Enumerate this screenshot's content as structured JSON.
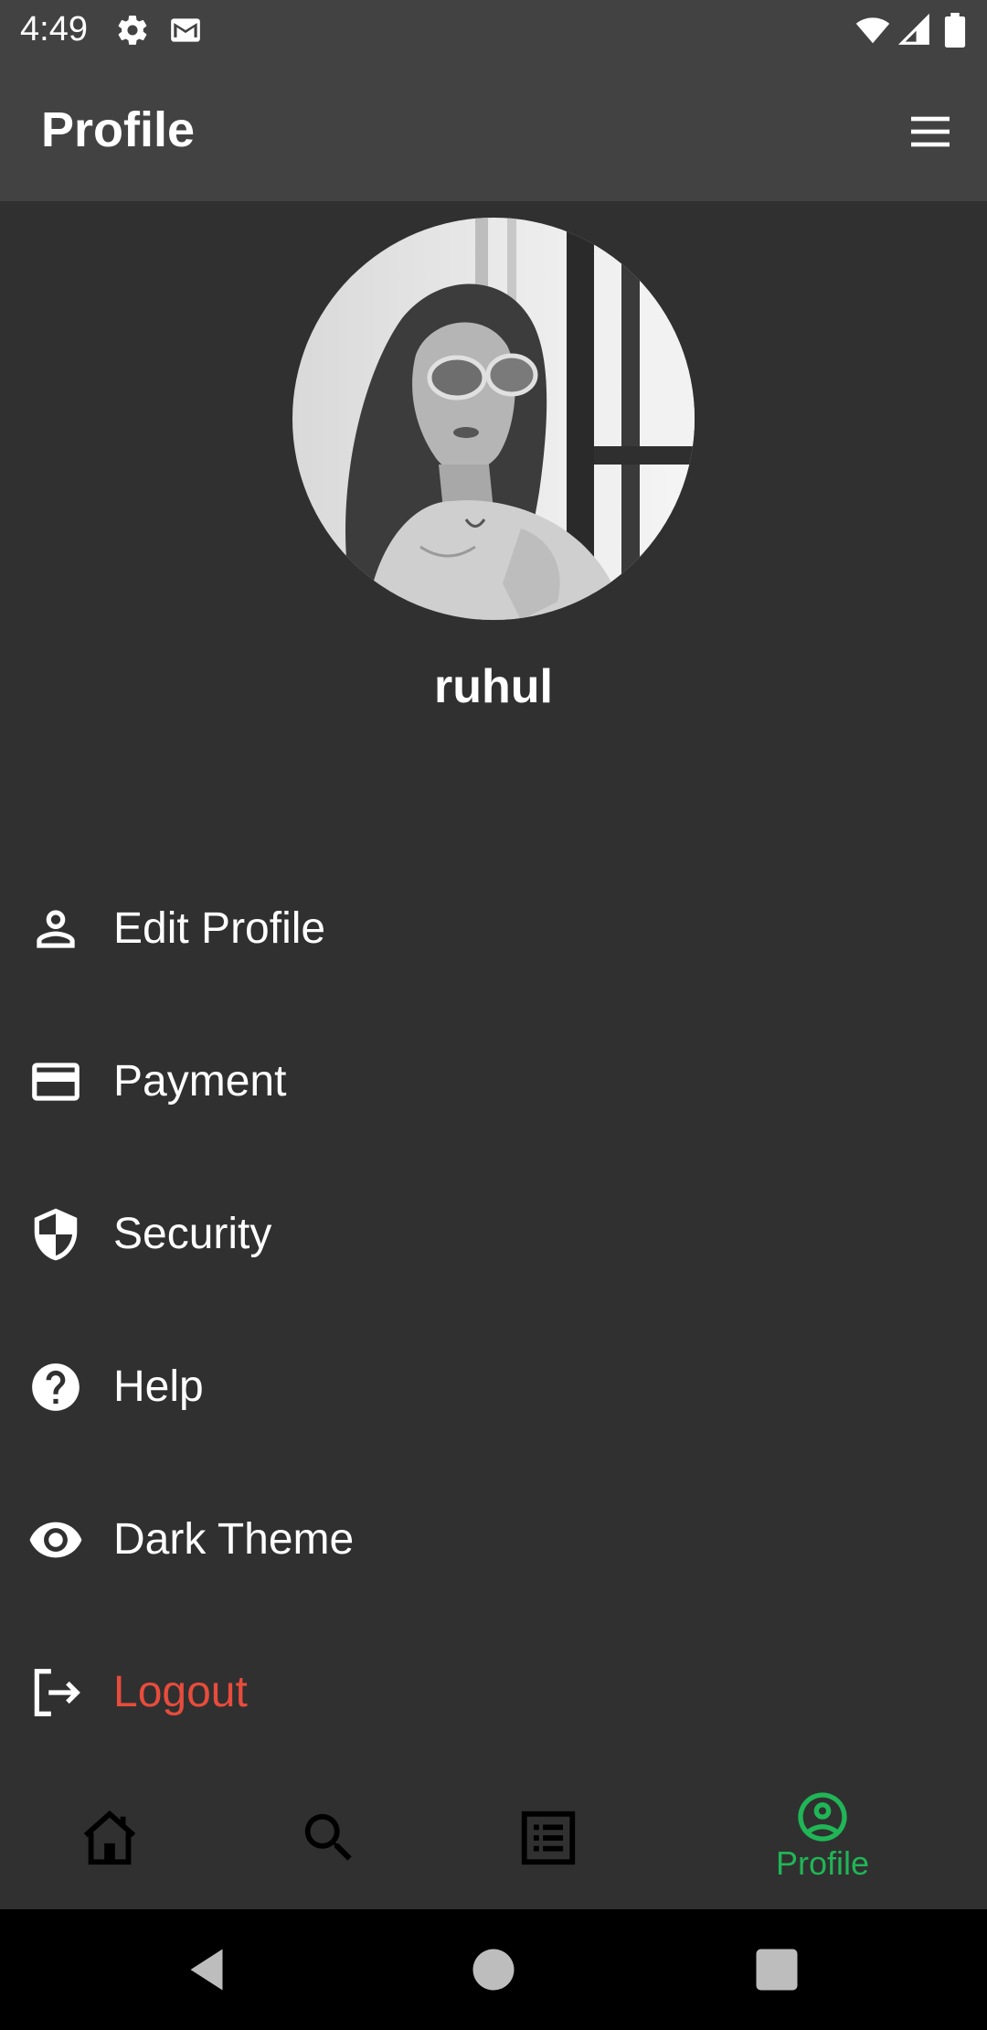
{
  "status_bar": {
    "time": "4:49",
    "left_icons": [
      "gear-icon",
      "gmail-icon"
    ],
    "right_icons": [
      "wifi-icon",
      "signal-icon",
      "battery-icon"
    ]
  },
  "app_bar": {
    "title": "Profile",
    "menu_icon": "hamburger-menu-icon"
  },
  "profile": {
    "name": "ruhul",
    "avatar": "user-avatar-photo"
  },
  "menu": {
    "items": [
      {
        "label": "Edit Profile",
        "icon": "person-icon"
      },
      {
        "label": "Payment",
        "icon": "credit-card-icon"
      },
      {
        "label": "Security",
        "icon": "shield-icon"
      },
      {
        "label": "Help",
        "icon": "help-circle-icon"
      },
      {
        "label": "Dark Theme",
        "icon": "eye-icon"
      },
      {
        "label": "Logout",
        "icon": "logout-icon",
        "color": "#e74c3c"
      }
    ]
  },
  "bottom_nav": {
    "items": [
      {
        "label": "",
        "icon": "home-icon"
      },
      {
        "label": "",
        "icon": "search-icon"
      },
      {
        "label": "",
        "icon": "list-icon"
      },
      {
        "label": "Profile",
        "icon": "account-circle-icon",
        "active": true
      }
    ],
    "active_color": "#20b556"
  },
  "system_nav": {
    "buttons": [
      "back-icon",
      "home-circle-icon",
      "recents-square-icon"
    ]
  },
  "colors": {
    "background": "#303030",
    "app_bar": "#424242",
    "accent": "#20b556",
    "danger": "#e74c3c"
  }
}
